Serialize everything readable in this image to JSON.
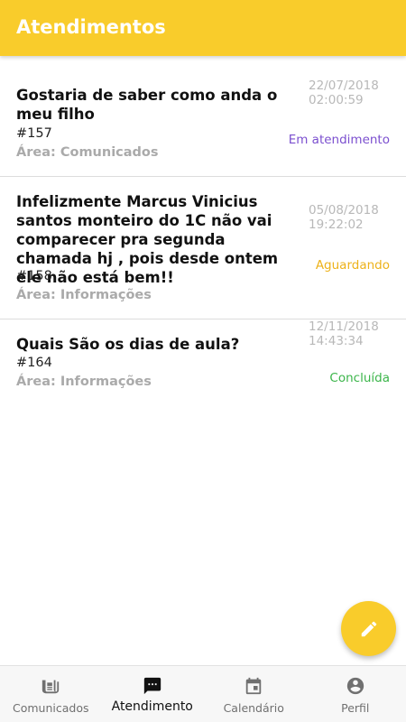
{
  "header": {
    "title": "Atendimentos"
  },
  "tickets": [
    {
      "title": "Gostaria de saber como anda o meu filho",
      "id": "#157",
      "area": "Área: Comunicados",
      "date": "22/07/2018",
      "time": "02:00:59",
      "status": "Em atendimento",
      "status_color": "#7B4FCF"
    },
    {
      "title": "Infelizmente Marcus Vinicius santos monteiro do 1C não vai comparecer pra segunda chamada hj , pois desde ontem ele não está bem!!",
      "id": "#158",
      "area": "Área: Informações",
      "date": "05/08/2018",
      "time": "19:22:02",
      "status": "Aguardando",
      "status_color": "#EDB21A"
    },
    {
      "title": "Quais São os dias de aula?",
      "id": "#164",
      "area": "Área: Informações",
      "date": "12/11/2018",
      "time": "14:43:34",
      "status": "Concluída",
      "status_color": "#3BB54A"
    }
  ],
  "fab": {
    "icon": "pencil-icon"
  },
  "bottom_nav": {
    "items": [
      {
        "label": "Comunicados",
        "icon": "newspaper-icon",
        "active": false
      },
      {
        "label": "Atendimento",
        "icon": "chat-icon",
        "active": true
      },
      {
        "label": "Calendário",
        "icon": "calendar-icon",
        "active": false
      },
      {
        "label": "Perfil",
        "icon": "account-circle-icon",
        "active": false
      }
    ]
  },
  "colors": {
    "accent": "#F9CC2B",
    "nav_active": "#111111",
    "nav_inactive": "#707070"
  }
}
